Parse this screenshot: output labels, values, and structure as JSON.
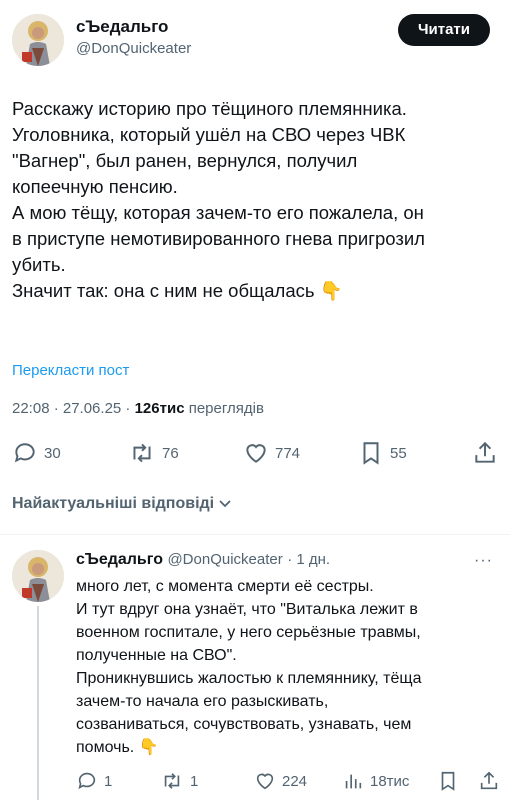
{
  "post": {
    "author_name": "сЪедальго",
    "author_handle": "@DonQuickeater",
    "follow_label": "Читати",
    "lines": [
      "Расскажу историю про тёщиного племянника.",
      "Уголовника, который ушёл на СВО через ЧВК",
      "\"Вагнер\", был ранен, вернулся, получил",
      "копеечную пенсию.",
      "А мою тёщу, которая зачем-то его пожалела, он",
      "в приступе немотивированного гнева пригрозил",
      "убить.",
      "Значит так: она с ним не общалась 👇"
    ],
    "translate_label": "Перекласти пост",
    "time": "22:08 · 27.06.25 ·",
    "views_count": "126тис",
    "views_label": "переглядів",
    "replies": "30",
    "reposts": "76",
    "likes": "774",
    "bookmarks": "55"
  },
  "sort_label": "Найактуальніші відповіді",
  "reply": {
    "author_name": "сЪедальго",
    "author_handle": "@DonQuickeater",
    "age": "· 1 дн.",
    "lines": [
      "много лет, с момента смерти её сестры.",
      "И тут вдруг она узнаёт, что \"Виталька лежит в",
      "военном госпитале, у него серьёзные травмы,",
      "полученные на СВО\".",
      "Проникнувшись жалостью к племяннику, тёща",
      "зачем-то начала его разыскивать,",
      "созваниваться, сочувствовать, узнавать, чем",
      "помочь. 👇"
    ],
    "replies": "1",
    "reposts": "1",
    "likes": "224",
    "views": "18тис"
  }
}
